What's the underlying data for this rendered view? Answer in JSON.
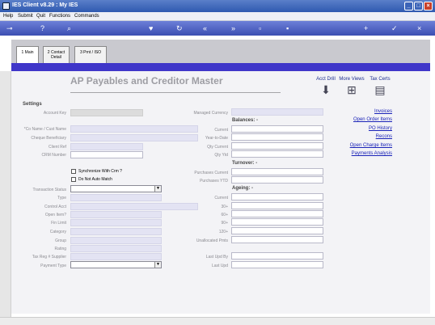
{
  "window": {
    "title": "IES Client v8.29 : My IES"
  },
  "menu": {
    "items": [
      "Help",
      "Submit",
      "Quit",
      "Functions",
      "Commands"
    ]
  },
  "toolbar": {
    "icons": [
      "key-icon",
      "help-icon",
      "search-icon",
      "heart-icon",
      "refresh-icon",
      "rewind-icon",
      "fast-forward-icon",
      "stop-icon",
      "save-icon",
      "add-icon",
      "check-icon",
      "close-icon"
    ]
  },
  "tabs": [
    {
      "label": "1 Main",
      "active": true
    },
    {
      "label": "2 Contact Detail",
      "active": false
    },
    {
      "label": "3 Prnt / ISO",
      "active": false
    }
  ],
  "page": {
    "title": "AP Payables and Creditor Master"
  },
  "tools": [
    {
      "label": "Acct Drill",
      "icon": "download-icon"
    },
    {
      "label": "More Views",
      "icon": "hierarchy-icon"
    },
    {
      "label": "Tax Certs",
      "icon": "certificate-icon"
    }
  ],
  "settings": {
    "heading": "Settings",
    "labels": {
      "account_key": "Account Key",
      "co_name": "*Co Name / Cust Name",
      "cheque_beneficiary": "Cheque Beneficiary",
      "client_ref": "Client Ref",
      "crm_number": "CRM Number",
      "transaction_status": "Transaction Status",
      "type": "Type",
      "control_acct": "Control Acct",
      "open_item": "Open Item?",
      "fin_limit": "Fin Limit",
      "category": "Category",
      "group": "Group",
      "rating": "Rating",
      "tax_reg": "Tax Reg # Supplier",
      "payment_type": "Payment Type"
    },
    "checkboxes": {
      "sync_crm": "Synchronize With Crm ?",
      "no_auto_match": "Do Not Auto Match"
    }
  },
  "managed_currency": "Managed Currency",
  "balances": {
    "heading": "Balances: -",
    "labels": [
      "Current",
      "Year-to-Date",
      "Qty Current",
      "Qty Ytd"
    ]
  },
  "turnover": {
    "heading": "Turnover: -",
    "labels": [
      "Purchases Current",
      "Purchases YTD"
    ]
  },
  "ageing": {
    "heading": "Ageing: -",
    "labels": [
      "Current",
      "30+",
      "60+",
      "90+",
      "120+",
      "Unallocated Pmts"
    ]
  },
  "audit": {
    "labels": [
      "Last Upd By",
      "Last Upd"
    ]
  },
  "links": [
    "Invoices",
    "Open Order Items",
    "PO History",
    "Recons",
    "Open Charge Items",
    "Payments Analysis"
  ]
}
